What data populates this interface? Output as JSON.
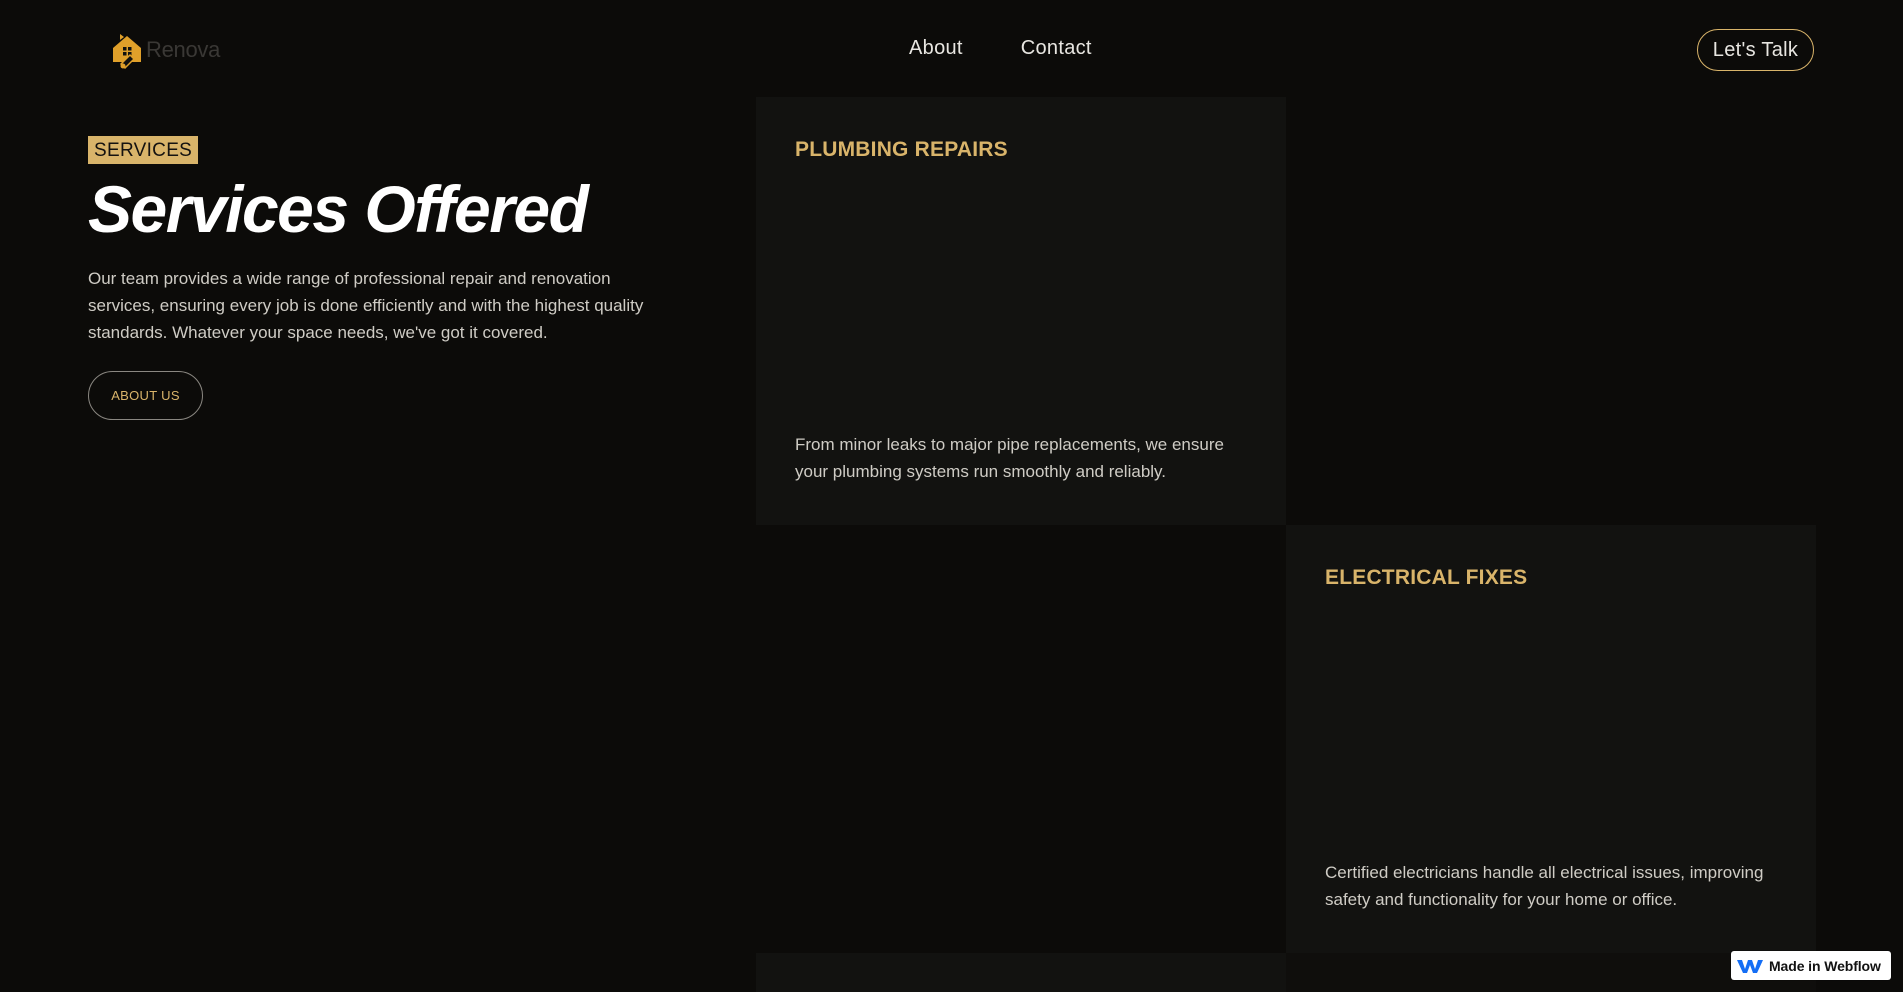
{
  "nav": {
    "logo_text": "Renova",
    "links": [
      "About",
      "Contact"
    ],
    "cta_label": "Let's Talk"
  },
  "hero": {
    "badge": "SERVICES",
    "title": "Services Offered",
    "description": "Our team provides a wide range of professional repair and renovation services, ensuring every job is done efficiently and with the highest quality standards. Whatever your space needs, we've got it covered.",
    "button_label": "ABOUT US"
  },
  "services": [
    {
      "title": "PLUMBING REPAIRS",
      "description": "From minor leaks to major pipe replacements, we ensure your plumbing systems run smoothly and reliably."
    },
    {
      "title": "ELECTRICAL FIXES",
      "description": "Certified electricians handle all electrical issues, improving safety and functionality for your home or office."
    }
  ],
  "webflow_badge": "Made in Webflow",
  "colors": {
    "background": "#0c0b09",
    "card": "#121210",
    "accent": "#d9b46a",
    "text": "#e8e6e1"
  },
  "icons": {
    "logo": "house-wrench-icon",
    "webflow": "webflow-logo-icon"
  }
}
